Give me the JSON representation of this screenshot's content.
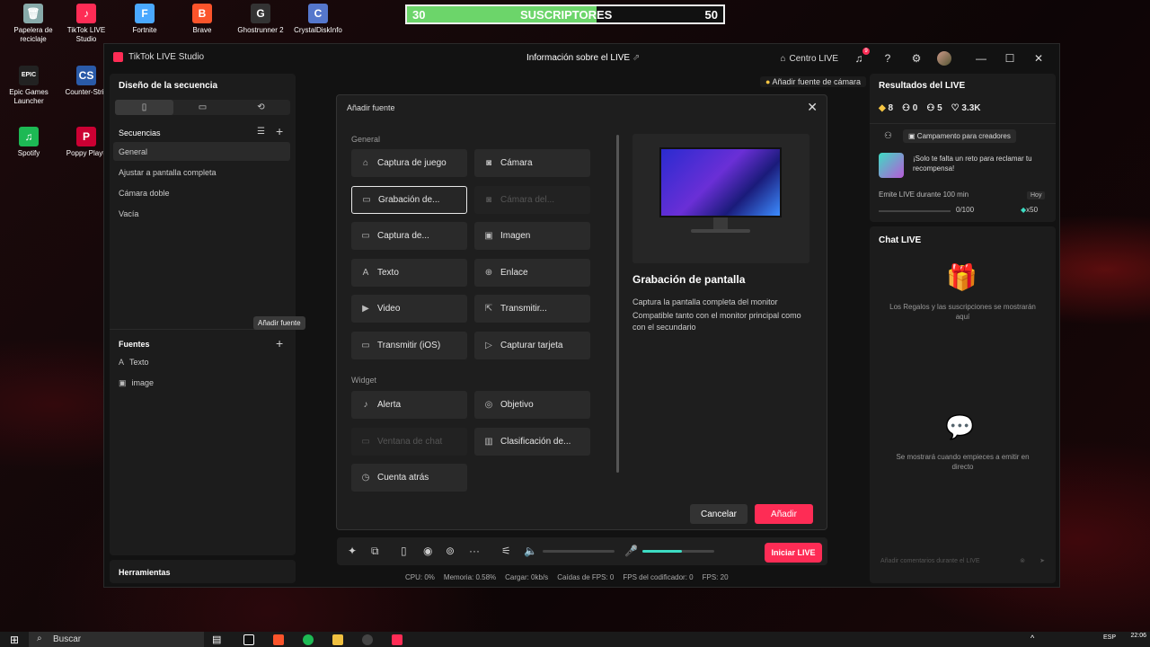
{
  "desktop": {
    "icons": [
      {
        "label": "Papelera de reciclaje",
        "glyph": "🗑",
        "color": "#8aa"
      },
      {
        "label": "TikTok LIVE Studio",
        "glyph": "♪",
        "color": "#fe2c55"
      },
      {
        "label": "Fortnite",
        "glyph": "F",
        "color": "#4aa8ff"
      },
      {
        "label": "Brave",
        "glyph": "B",
        "color": "#fb542b"
      },
      {
        "label": "Ghostrunner 2",
        "glyph": "G",
        "color": "#333"
      },
      {
        "label": "CrystalDiskInfo",
        "glyph": "C",
        "color": "#5577cc"
      },
      {
        "label": "Epic Games Launcher",
        "glyph": "EPIC",
        "color": "#222"
      },
      {
        "label": "Counter-Strik",
        "glyph": "CS",
        "color": "#2a5aa8"
      },
      {
        "label": "Spotify",
        "glyph": "♫",
        "color": "#1db954"
      },
      {
        "label": "Poppy Playti",
        "glyph": "P",
        "color": "#c03"
      }
    ]
  },
  "subscribers": {
    "current": "30",
    "label": "SUSCRIPTORES",
    "goal": "50",
    "progress": 0.6
  },
  "app": {
    "title": "TikTok LIVE Studio",
    "center_title": "Información sobre el LIVE",
    "centro_live": "Centro LIVE",
    "notif_count": "9"
  },
  "left": {
    "scene_design": "Diseño de la secuencia",
    "sequences_label": "Secuencias",
    "sequences": [
      "General",
      "Ajustar a pantalla completa",
      "Cámara doble",
      "Vacía"
    ],
    "sources_label": "Fuentes",
    "sources": [
      {
        "label": "Texto",
        "icon": "A"
      },
      {
        "label": "image",
        "icon": "▣"
      }
    ],
    "tools_label": "Herramientas",
    "add_source_tooltip": "Añadir fuente"
  },
  "add_camera": "Añadir fuente de cámara",
  "modal": {
    "title": "Añadir fuente",
    "general_label": "General",
    "widget_label": "Widget",
    "general_sources": [
      {
        "label": "Captura de juego",
        "icon": "⌂"
      },
      {
        "label": "Cámara",
        "icon": "◙"
      },
      {
        "label": "Grabación de...",
        "icon": "▭"
      },
      {
        "label": "Cámara del...",
        "icon": "◙"
      },
      {
        "label": "Captura de...",
        "icon": "▭"
      },
      {
        "label": "Imagen",
        "icon": "▣"
      },
      {
        "label": "Texto",
        "icon": "A"
      },
      {
        "label": "Enlace",
        "icon": "⊕"
      },
      {
        "label": "Video",
        "icon": "▶"
      },
      {
        "label": "Transmitir...",
        "icon": "⇱"
      },
      {
        "label": "Transmitir (iOS)",
        "icon": "▭"
      },
      {
        "label": "Capturar tarjeta",
        "icon": "▷"
      }
    ],
    "widget_sources": [
      {
        "label": "Alerta",
        "icon": "♪"
      },
      {
        "label": "Objetivo",
        "icon": "◎"
      },
      {
        "label": "Ventana de chat",
        "icon": "▭"
      },
      {
        "label": "Clasificación de...",
        "icon": "▥"
      },
      {
        "label": "Cuenta atrás",
        "icon": "◷"
      }
    ],
    "preview_title": "Grabación de pantalla",
    "preview_lines": [
      "Captura la pantalla completa del monitor",
      "Compatible tanto con el monitor principal como con el secundario"
    ],
    "cancel": "Cancelar",
    "add": "Añadir"
  },
  "results": {
    "title": "Resultados del LIVE",
    "stats": [
      {
        "icon": "◆",
        "value": "8",
        "color": "#f5c542"
      },
      {
        "icon": "⚇",
        "value": "0",
        "color": "#fff"
      },
      {
        "icon": "⚇",
        "value": "5",
        "color": "#fff"
      },
      {
        "icon": "♡",
        "value": "3.3K",
        "color": "#fff"
      }
    ],
    "campaign": "Campamento para creadores",
    "challenge": "¡Solo te falta un reto para reclamar tu recompensa!",
    "task": "Emite LIVE durante 100 min",
    "today": "Hoy",
    "task_progress": "0/100",
    "reward": "x50"
  },
  "chat": {
    "title": "Chat LIVE",
    "gifts_msg": "Los Regalos y las suscripciones se mostrarán aquí",
    "live_msg": "Se mostrará cuando empieces a emitir en directo",
    "input_placeholder": "Añadir comentarios durante el LIVE"
  },
  "controls": {
    "go_live": "Iniciar LIVE",
    "mic_level": 0.55
  },
  "status": {
    "cpu": "CPU:  0%",
    "mem": "Memoria:  0.58%",
    "upload": "Cargar:  0kb/s",
    "fps_drop": "Caídas de FPS:  0",
    "encoder": "FPS del codificador:  0",
    "fps": "FPS:  20"
  },
  "taskbar": {
    "search": "Buscar",
    "time": "22:06",
    "lang": "ESP"
  }
}
